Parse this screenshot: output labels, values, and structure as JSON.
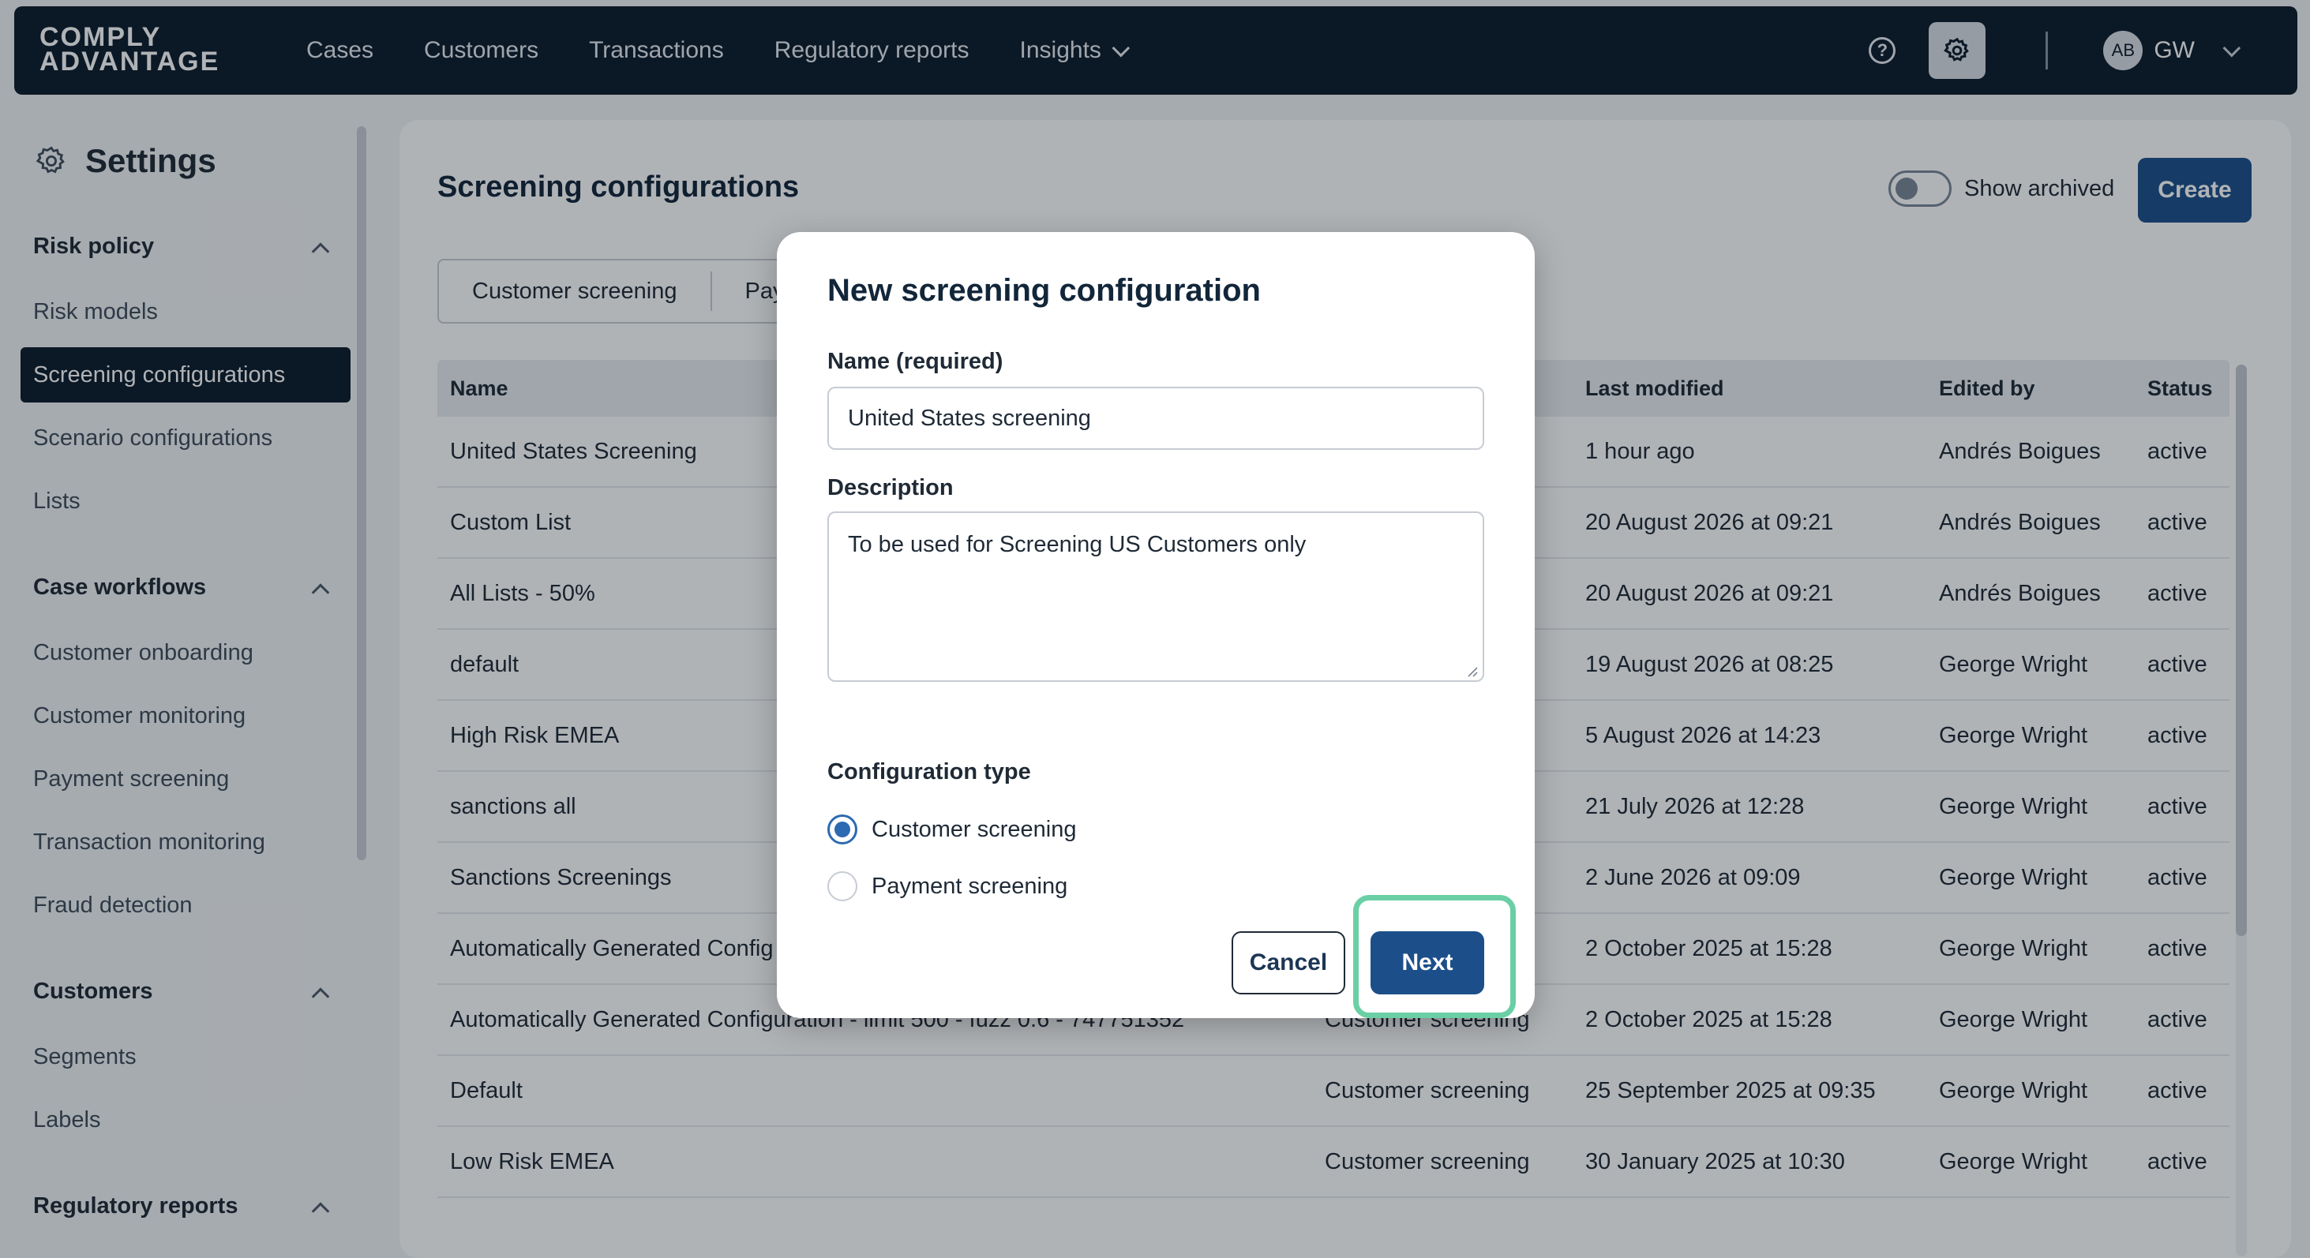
{
  "brand": {
    "line1": "COMPLY",
    "line2": "ADVANTAGE"
  },
  "nav": {
    "links": [
      "Cases",
      "Customers",
      "Transactions",
      "Regulatory reports",
      "Insights"
    ],
    "user_avatar": "AB",
    "user_initials": "GW"
  },
  "sidebar": {
    "title": "Settings",
    "sections": [
      {
        "label": "Risk policy",
        "items": [
          "Risk models",
          "Screening configurations",
          "Scenario configurations",
          "Lists"
        ]
      },
      {
        "label": "Case workflows",
        "items": [
          "Customer onboarding",
          "Customer monitoring",
          "Payment screening",
          "Transaction monitoring",
          "Fraud detection"
        ]
      },
      {
        "label": "Customers",
        "items": [
          "Segments",
          "Labels"
        ]
      },
      {
        "label": "Regulatory reports",
        "items": []
      }
    ],
    "active_item": "Screening configurations"
  },
  "main": {
    "title": "Screening configurations",
    "show_archived_label": "Show archived",
    "create_label": "Create",
    "tabs": [
      "Customer screening",
      "Pay"
    ],
    "columns": [
      "Name",
      "Last modified",
      "Edited by",
      "Status"
    ],
    "rows": [
      {
        "name": "United States Screening",
        "type": "",
        "modified": "1 hour ago",
        "edited_by": "Andrés Boigues",
        "status": "active"
      },
      {
        "name": "Custom List",
        "type": "",
        "modified": "20 August 2026 at 09:21",
        "edited_by": "Andrés Boigues",
        "status": "active"
      },
      {
        "name": "All Lists - 50%",
        "type": "",
        "modified": "20 August 2026 at 09:21",
        "edited_by": "Andrés Boigues",
        "status": "active"
      },
      {
        "name": "default",
        "type": "",
        "modified": "19 August 2026 at 08:25",
        "edited_by": "George Wright",
        "status": "active"
      },
      {
        "name": "High Risk EMEA",
        "type": "",
        "modified": "5 August 2026 at 14:23",
        "edited_by": "George Wright",
        "status": "active"
      },
      {
        "name": "sanctions all",
        "type": "",
        "modified": "21 July 2026 at 12:28",
        "edited_by": "George Wright",
        "status": "active"
      },
      {
        "name": "Sanctions Screenings",
        "type": "",
        "modified": "2 June 2026 at 09:09",
        "edited_by": "George Wright",
        "status": "active"
      },
      {
        "name": "Automatically Generated Config",
        "type": "",
        "modified": "2 October 2025 at 15:28",
        "edited_by": "George Wright",
        "status": "active"
      },
      {
        "name": "Automatically Generated Configuration - limit 500 - fuzz 0.6 - 747751352",
        "type": "Customer screening",
        "modified": "2 October 2025 at 15:28",
        "edited_by": "George Wright",
        "status": "active"
      },
      {
        "name": "Default",
        "type": "Customer screening",
        "modified": "25 September 2025 at 09:35",
        "edited_by": "George Wright",
        "status": "active"
      },
      {
        "name": "Low Risk EMEA",
        "type": "Customer screening",
        "modified": "30 January 2025 at 10:30",
        "edited_by": "George Wright",
        "status": "active"
      }
    ]
  },
  "modal": {
    "title": "New screening configuration",
    "name_label": "Name (required)",
    "name_value": "United States screening",
    "description_label": "Description",
    "description_value": "To be used for Screening US Customers only",
    "config_type_label": "Configuration type",
    "options": [
      "Customer screening",
      "Payment screening"
    ],
    "selected_option": "Customer screening",
    "cancel_label": "Cancel",
    "next_label": "Next"
  },
  "colors": {
    "nav_bg": "#0d1b2a",
    "primary": "#1c4f8a",
    "radio_accent": "#2c6ab1",
    "highlight": "#6bcfa5"
  }
}
